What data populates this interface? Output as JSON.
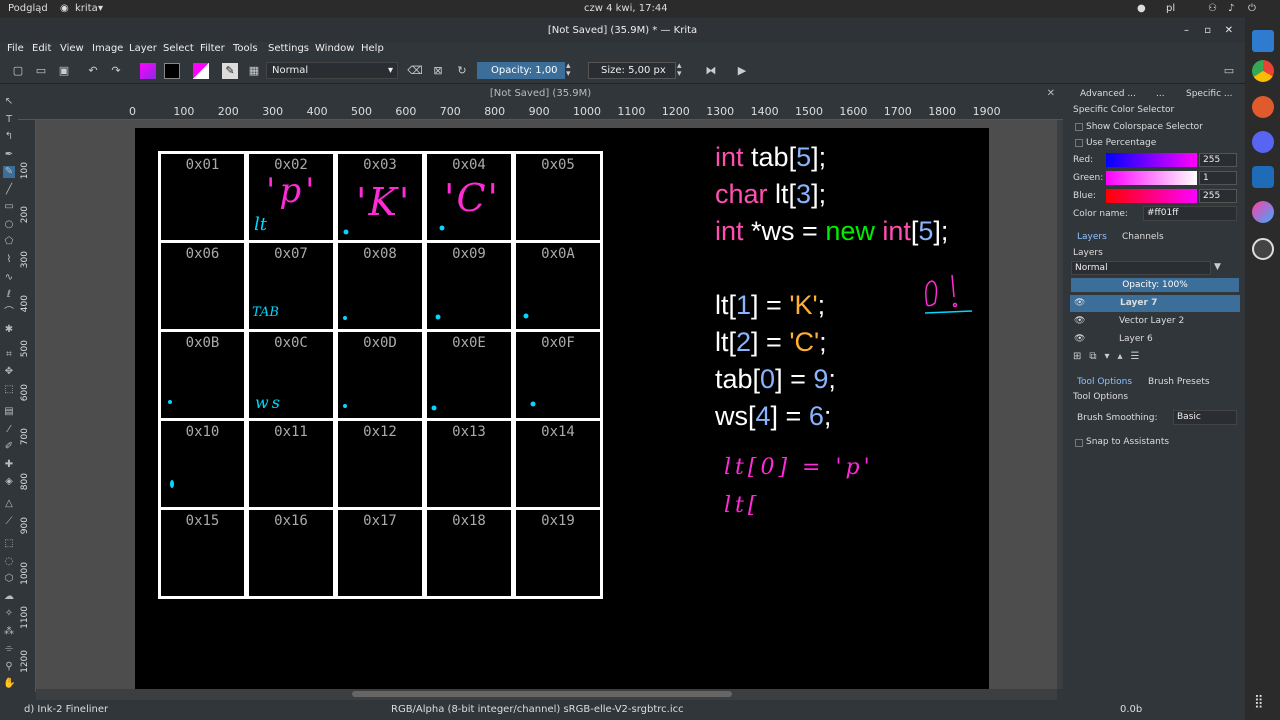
{
  "topbar": {
    "app_menu": "Podgląd",
    "window_menu": "krita",
    "clock": "czw 4 kwi, 17:44",
    "lang": "pl"
  },
  "window": {
    "title": "[Not Saved]  (35.9M) * — Krita"
  },
  "menu": [
    "File",
    "Edit",
    "View",
    "Image",
    "Layer",
    "Select",
    "Filter",
    "Tools",
    "Settings",
    "Window",
    "Help"
  ],
  "toolbar": {
    "blend_mode": "Normal",
    "opacity": "Opacity:  1,00",
    "size": "Size:  5,00 px"
  },
  "doc": {
    "tab_title": "[Not Saved]  (35.9M)"
  },
  "ruler": {
    "h": [
      "0",
      "100",
      "200",
      "300",
      "400",
      "500",
      "600",
      "700",
      "800",
      "900",
      "1000",
      "1100",
      "1200",
      "1300",
      "1400",
      "1500",
      "1600",
      "1700",
      "1800",
      "1900"
    ],
    "v": [
      "100",
      "200",
      "300",
      "400",
      "500",
      "600",
      "700",
      "800",
      "900",
      "1000",
      "1100",
      "1200"
    ]
  },
  "grid": {
    "labels": [
      [
        "0x01",
        "0x02",
        "0x03",
        "0x04",
        "0x05"
      ],
      [
        "0x06",
        "0x07",
        "0x08",
        "0x09",
        "0x0A"
      ],
      [
        "0x0B",
        "0x0C",
        "0x0D",
        "0x0E",
        "0x0F"
      ],
      [
        "0x10",
        "0x11",
        "0x12",
        "0x13",
        "0x14"
      ],
      [
        "0x15",
        "0x16",
        "0x17",
        "0x18",
        "0x19"
      ]
    ]
  },
  "handwriting": {
    "p": "'p'",
    "k": "'K'",
    "c": "'C'",
    "lt": "lt",
    "tab": "TAB",
    "ws": "ws",
    "zero": "0!",
    "note1": "lt[0] = 'p'",
    "note2": "lt["
  },
  "code": {
    "l1": {
      "a": "int",
      "b": " tab[",
      "c": "5",
      "d": "];"
    },
    "l2": {
      "a": "char",
      "b": " lt[",
      "c": "3",
      "d": "];"
    },
    "l3": {
      "a": "int",
      "b": " *ws = ",
      "c": "new",
      "d": " int",
      "e": "[",
      "f": "5",
      "g": "];"
    },
    "l4": {
      "a": "lt[",
      "b": "1",
      "c": "] = ",
      "d": "'K'",
      "e": ";"
    },
    "l5": {
      "a": "lt[",
      "b": "2",
      "c": "] = ",
      "d": "'C'",
      "e": ";"
    },
    "l6": {
      "a": "tab[",
      "b": "0",
      "c": "] = ",
      "d": "9",
      "e": ";"
    },
    "l7": {
      "a": "ws[",
      "b": "4",
      "c": "] = ",
      "d": "6",
      "e": ";"
    }
  },
  "panel": {
    "tab1": "Advanced ...",
    "tab2": "...",
    "tab3": "Specific ...",
    "title": "Specific Color Selector",
    "show_cs": "Show Colorspace Selector",
    "use_pct": "Use Percentage",
    "red_label": "Red:",
    "green_label": "Green:",
    "blue_label": "Blue:",
    "red": "255",
    "green": "1",
    "blue": "255",
    "color_name_label": "Color name:",
    "color_name": "#ff01ff",
    "layers_tab": "Layers",
    "channels_tab": "Channels",
    "layers_title": "Layers",
    "layer_blend": "Normal",
    "layer_opacity": "Opacity:  100%",
    "layers": [
      "Layer 7",
      "Vector Layer 2",
      "Layer 6"
    ],
    "tool_options_tab": "Tool Options",
    "brush_presets_tab": "Brush Presets",
    "tool_options_title": "Tool Options",
    "brush_smoothing_label": "Brush Smoothing:",
    "brush_smoothing": "Basic",
    "snap": "Snap to Assistants"
  },
  "status": {
    "brush": "d) Ink-2 Fineliner",
    "color_info": "RGB/Alpha (8-bit integer/channel)  sRGB-elle-V2-srgbtrc.icc",
    "size": "0.0b"
  },
  "colors": {
    "fg": "#ff01ff",
    "accent": "#3c6e9a",
    "ink_cyan": "#00d8ff",
    "ink_magenta": "#ff2bd6"
  }
}
